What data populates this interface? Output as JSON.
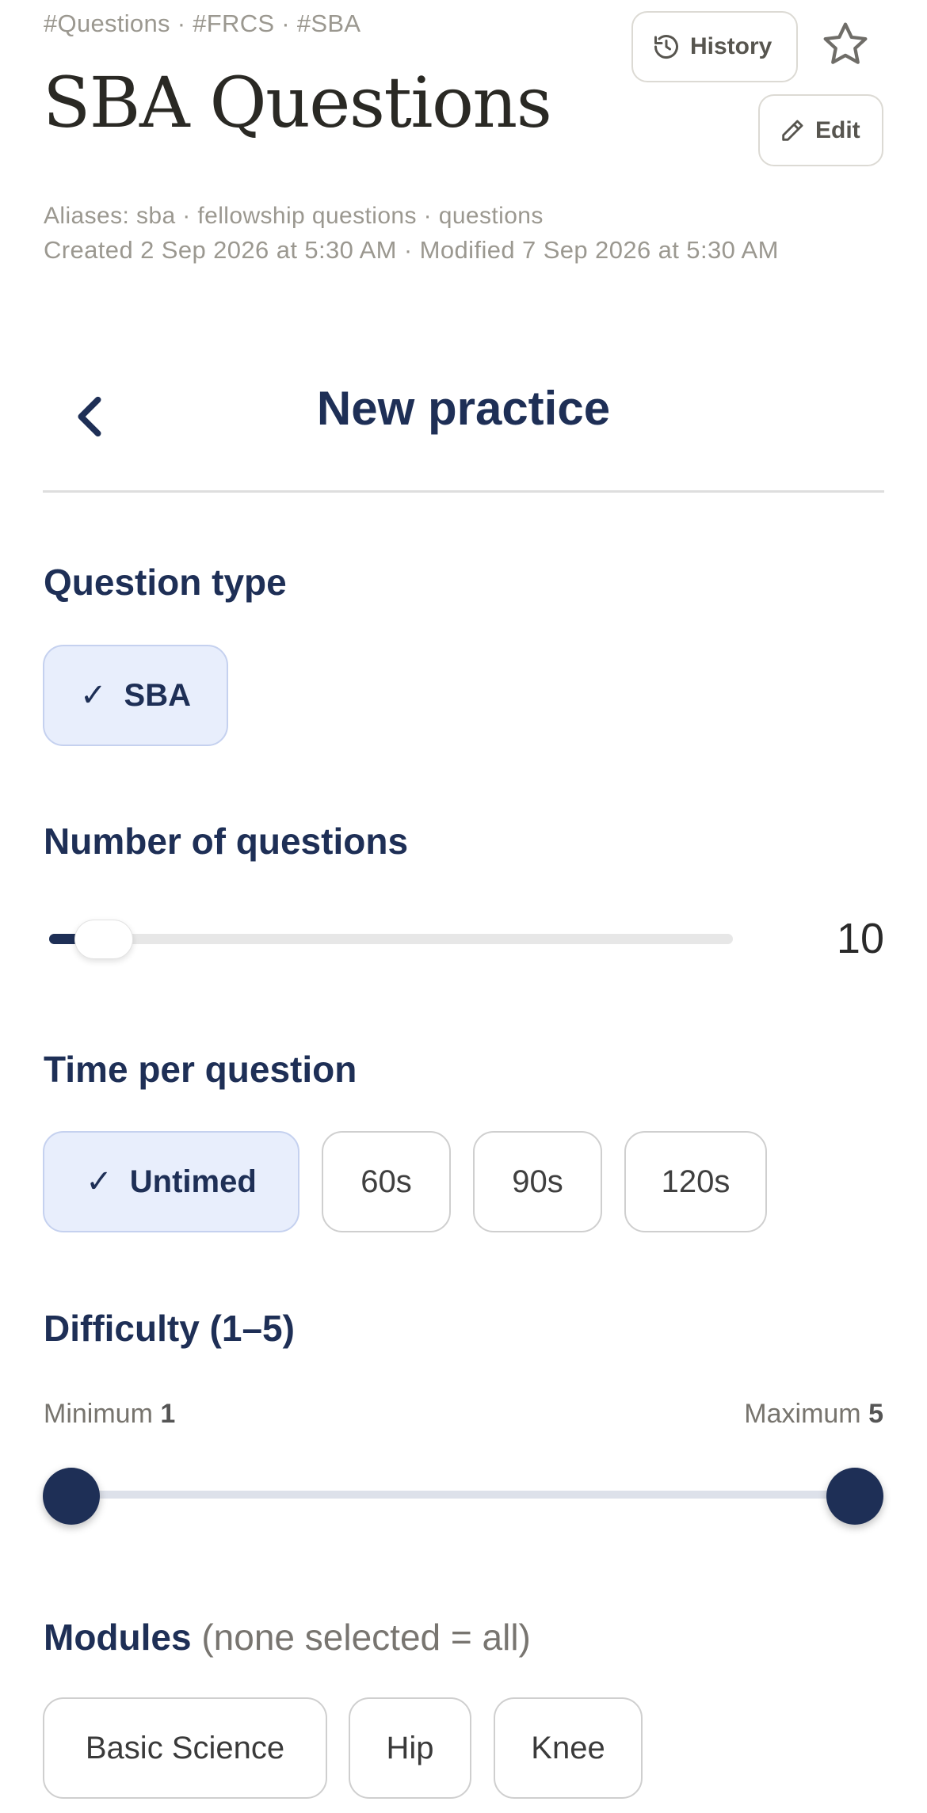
{
  "header": {
    "tags": "#Questions · #FRCS · #SBA",
    "title": "SBA Questions",
    "history_label": "History",
    "edit_label": "Edit",
    "aliases": "Aliases: sba · fellowship questions · questions",
    "dates": "Created 2 Sep 2026 at 5:30 AM  ·  Modified 7 Sep 2026 at 5:30 AM"
  },
  "icons": {
    "history": "history-icon",
    "edit": "pencil-icon",
    "star": "star-outline-icon",
    "back": "chevron-left-icon",
    "check": "checkmark-icon"
  },
  "practice": {
    "title": "New practice",
    "question_type": {
      "label": "Question type",
      "options": [
        {
          "label": "SBA",
          "selected": true
        }
      ]
    },
    "number_of_questions": {
      "label": "Number of questions",
      "value": "10",
      "slider_fraction": 0.05
    },
    "time_per_question": {
      "label": "Time per question",
      "options": [
        {
          "label": "Untimed",
          "selected": true
        },
        {
          "label": "60s",
          "selected": false
        },
        {
          "label": "90s",
          "selected": false
        },
        {
          "label": "120s",
          "selected": false
        }
      ]
    },
    "difficulty": {
      "label": "Difficulty (1–5)",
      "min_label": "Minimum",
      "min_value": "1",
      "max_label": "Maximum",
      "max_value": "5"
    },
    "modules": {
      "label": "Modules",
      "note": "(none selected = all)",
      "options": [
        {
          "label": "Basic Science",
          "selected": false
        },
        {
          "label": "Hip",
          "selected": false
        },
        {
          "label": "Knee",
          "selected": false
        }
      ]
    }
  },
  "colors": {
    "navy": "#1e2f56",
    "muted_text": "#9b9890",
    "selected_chip_bg": "#e8eefc"
  }
}
